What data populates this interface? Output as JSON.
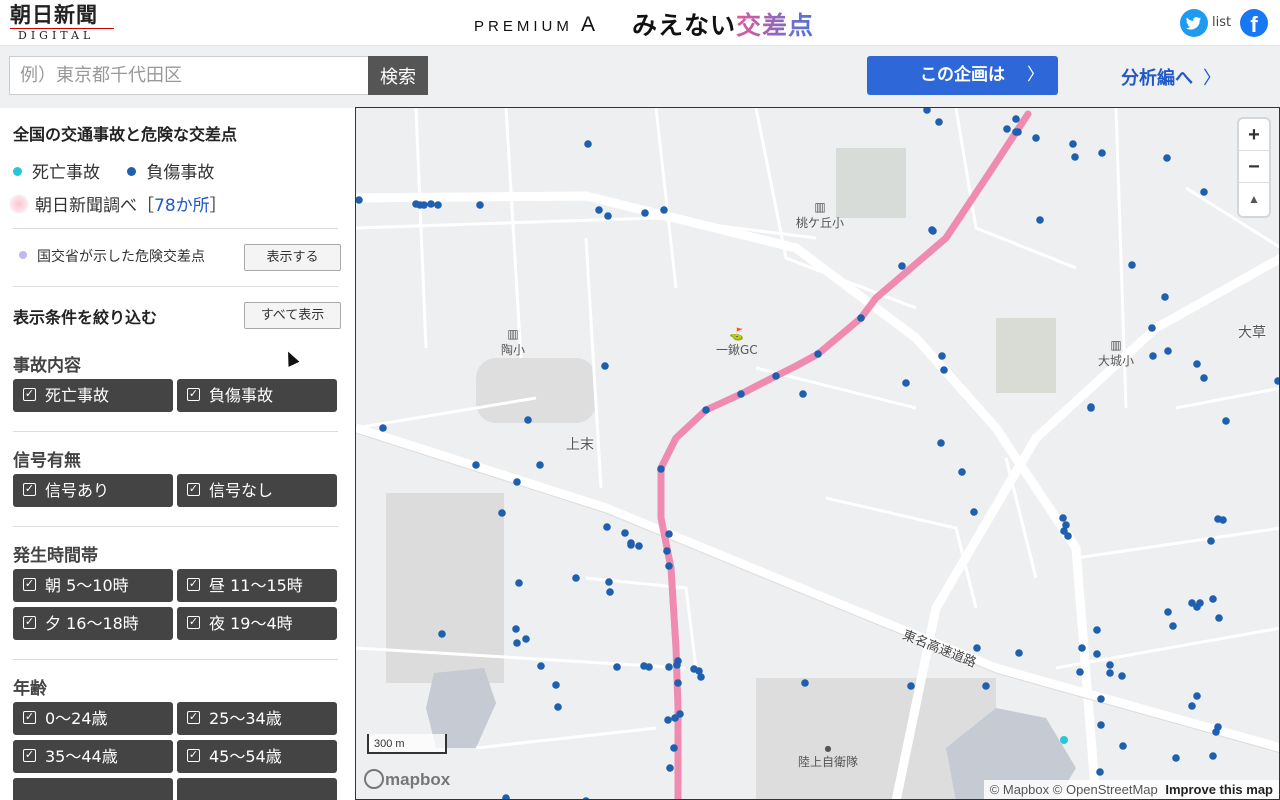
{
  "header": {
    "logo_main": "朝日新聞",
    "logo_sub": "DIGITAL",
    "premium_label": "PREMIUM",
    "premium_mark": "A",
    "series_title_prefix": "みえない",
    "series_title_accent": "交差点",
    "list_label": "list",
    "facebook_glyph": "f",
    "twitter_icon": "twitter-icon",
    "facebook_icon": "facebook-icon"
  },
  "search": {
    "placeholder": "例）東京都千代田区",
    "value": "",
    "button_label": "検索",
    "about_label": "この企画は",
    "about_chevron": "〉",
    "analysis_label": "分析編へ",
    "analysis_chevron": "〉"
  },
  "sidebar": {
    "title": "全国の交通事故と危険な交差点",
    "legend": {
      "fatal_label": "死亡事故",
      "fatal_color": "#29c6d8",
      "injury_label": "負傷事故",
      "injury_color": "#1f5fb0",
      "survey_label": "朝日新聞調べ［",
      "survey_count": "78か所",
      "survey_suffix": "］"
    },
    "mlit_label": "国交省が示した危険交差点",
    "mlit_color": "#c3b8e8",
    "show_button": "表示する",
    "filter_title": "表示条件を絞り込む",
    "show_all_button": "すべて表示",
    "check_mark": "✓",
    "groups": [
      {
        "title": "事故内容",
        "options": [
          "死亡事故",
          "負傷事故"
        ]
      },
      {
        "title": "信号有無",
        "options": [
          "信号あり",
          "信号なし"
        ]
      },
      {
        "title": "発生時間帯",
        "options": [
          "朝 5〜10時",
          "昼 11〜15時",
          "夕 16〜18時",
          "夜 19〜4時"
        ]
      },
      {
        "title": "年齢",
        "options": [
          "0〜24歳",
          "25〜34歳",
          "35〜44歳",
          "45〜54歳"
        ]
      }
    ]
  },
  "map": {
    "labels": {
      "momogaoka": "桃ケ丘小",
      "golf": "一鍬GC",
      "suemura": "陶小",
      "kamisue": "上末",
      "oshiro": "大城小",
      "okusa": "大草",
      "expressway": "東名高速道路",
      "jsdf": "陸上自衛隊"
    },
    "zoom_in": "+",
    "zoom_out": "−",
    "compass": "▲",
    "scale_label": "300 m",
    "mapbox_logo": "mapbox",
    "attribution_mapbox": "© Mapbox",
    "attribution_osm": "© OpenStreetMap",
    "attribution_improve": "Improve this map",
    "route_color": "#ee7fa8",
    "injury_points": 120,
    "fatal_points": 1
  }
}
